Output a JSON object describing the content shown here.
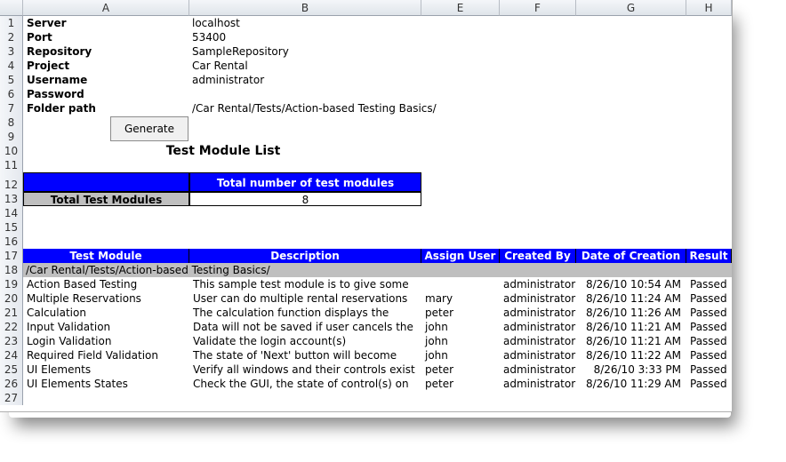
{
  "columns": [
    "A",
    "B",
    "E",
    "F",
    "G",
    "H"
  ],
  "rows": [
    "1",
    "2",
    "3",
    "4",
    "5",
    "6",
    "7",
    "8",
    "9",
    "10",
    "11",
    "12",
    "13",
    "14",
    "15",
    "16",
    "17",
    "18",
    "19",
    "20",
    "21",
    "22",
    "23",
    "24",
    "25",
    "26",
    "27"
  ],
  "settings": [
    {
      "label": "Server",
      "value": "localhost"
    },
    {
      "label": "Port",
      "value": "53400"
    },
    {
      "label": "Repository",
      "value": "SampleRepository"
    },
    {
      "label": "Project",
      "value": "Car Rental"
    },
    {
      "label": "Username",
      "value": "administrator"
    },
    {
      "label": "Password",
      "value": ""
    },
    {
      "label": "Folder path",
      "value": "/Car Rental/Tests/Action-based Testing Basics/"
    }
  ],
  "generate_button": "Generate",
  "list_title": "Test Module List",
  "summary": {
    "header": "Total number of test modules",
    "label": "Total Test Modules",
    "value": "8"
  },
  "table": {
    "headers": [
      "Test Module",
      "Description",
      "Assign User",
      "Created By",
      "Date of Creation",
      "Result"
    ],
    "folder": "/Car Rental/Tests/Action-based Testing Basics/",
    "rows": [
      [
        "Action Based Testing",
        "This sample test module is to give some",
        "",
        "administrator",
        "8/26/10 10:54 AM",
        "Passed"
      ],
      [
        "Multiple Reservations",
        "User can do multiple rental reservations",
        "mary",
        "administrator",
        "8/26/10 11:24 AM",
        "Passed"
      ],
      [
        "Calculation",
        "The calculation function displays the",
        "peter",
        "administrator",
        "8/26/10 11:26 AM",
        "Passed"
      ],
      [
        "Input Validation",
        "Data will not be saved if user cancels the",
        "john",
        "administrator",
        "8/26/10 11:21 AM",
        "Passed"
      ],
      [
        "Login Validation",
        "Validate the login account(s)",
        "john",
        "administrator",
        "8/26/10 11:21 AM",
        "Passed"
      ],
      [
        "Required Field Validation",
        "The state of 'Next' button will become",
        "john",
        "administrator",
        "8/26/10 11:22 AM",
        "Passed"
      ],
      [
        "UI Elements",
        "Verify all windows and their controls exist",
        "peter",
        "administrator",
        "8/26/10 3:33 PM",
        "Passed"
      ],
      [
        "UI Elements States",
        "Check the GUI, the state of control(s) on",
        "peter",
        "administrator",
        "8/26/10 11:29 AM",
        "Passed"
      ]
    ]
  }
}
